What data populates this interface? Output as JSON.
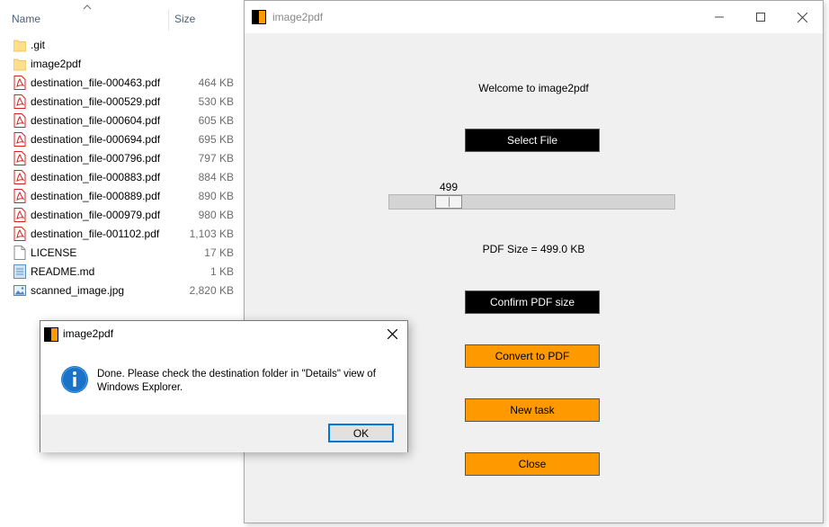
{
  "explorer": {
    "columns": {
      "name": "Name",
      "size": "Size"
    },
    "files": [
      {
        "name": ".git",
        "size": "",
        "icon": "folder-icon"
      },
      {
        "name": "image2pdf",
        "size": "",
        "icon": "folder-icon"
      },
      {
        "name": "destination_file-000463.pdf",
        "size": "464 KB",
        "icon": "pdf-icon"
      },
      {
        "name": "destination_file-000529.pdf",
        "size": "530 KB",
        "icon": "pdf-icon"
      },
      {
        "name": "destination_file-000604.pdf",
        "size": "605 KB",
        "icon": "pdf-icon"
      },
      {
        "name": "destination_file-000694.pdf",
        "size": "695 KB",
        "icon": "pdf-icon"
      },
      {
        "name": "destination_file-000796.pdf",
        "size": "797 KB",
        "icon": "pdf-icon"
      },
      {
        "name": "destination_file-000883.pdf",
        "size": "884 KB",
        "icon": "pdf-icon"
      },
      {
        "name": "destination_file-000889.pdf",
        "size": "890 KB",
        "icon": "pdf-icon"
      },
      {
        "name": "destination_file-000979.pdf",
        "size": "980 KB",
        "icon": "pdf-icon"
      },
      {
        "name": "destination_file-001102.pdf",
        "size": "1,103 KB",
        "icon": "pdf-icon"
      },
      {
        "name": "LICENSE",
        "size": "17 KB",
        "icon": "document-icon"
      },
      {
        "name": "README.md",
        "size": "1 KB",
        "icon": "markdown-icon"
      },
      {
        "name": "scanned_image.jpg",
        "size": "2,820 KB",
        "icon": "image-icon"
      }
    ]
  },
  "main_window": {
    "title": "image2pdf",
    "welcome": "Welcome to image2pdf",
    "select_file": "Select File",
    "slider": {
      "value": "499",
      "fraction": 0.2
    },
    "pdf_size": "PDF Size = 499.0 KB",
    "confirm": "Confirm PDF size",
    "convert": "Convert to PDF",
    "new_task": "New task",
    "close": "Close"
  },
  "dialog": {
    "title": "image2pdf",
    "message": "Done. Please check the destination folder in \"Details\" view of Windows Explorer.",
    "ok": "OK"
  },
  "colors": {
    "accent_orange": "#ff9900",
    "black_button": "#000000",
    "focus_blue": "#0078d7",
    "info_blue": "#1a73c8"
  }
}
